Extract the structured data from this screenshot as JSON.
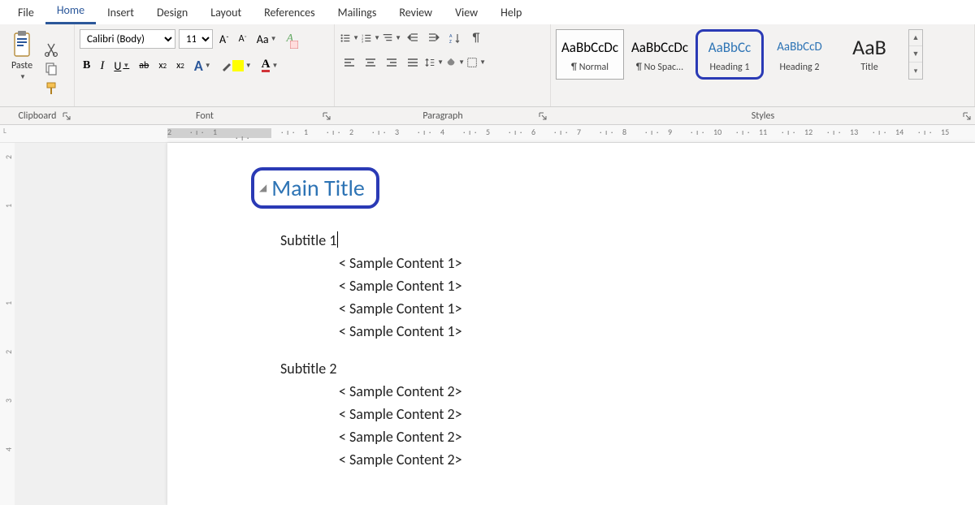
{
  "tabs": {
    "items": [
      "File",
      "Home",
      "Insert",
      "Design",
      "Layout",
      "References",
      "Mailings",
      "Review",
      "View",
      "Help"
    ],
    "active": "Home"
  },
  "ribbon": {
    "clipboard": {
      "label": "Clipboard",
      "paste": "Paste"
    },
    "font": {
      "label": "Font",
      "family": "Calibri (Body)",
      "size": "11",
      "bold": "B",
      "italic": "I",
      "underline": "U",
      "strike": "ab",
      "sub": "x",
      "sup": "x",
      "effects": "A",
      "fontcolor": "A",
      "incA": "A",
      "decA": "A",
      "aa": "Aa",
      "clearGlyph": "A"
    },
    "paragraph": {
      "label": "Paragraph",
      "pilcrow": "¶",
      "sort": "A↓Z"
    },
    "styles": {
      "label": "Styles",
      "items": [
        {
          "preview": "AaBbCcDc",
          "name": "¶ Normal",
          "cls": "",
          "sel": true
        },
        {
          "preview": "AaBbCcDc",
          "name": "¶ No Spac...",
          "cls": ""
        },
        {
          "preview": "AaBbCc",
          "name": "Heading 1",
          "cls": "h1",
          "hl": true
        },
        {
          "preview": "AaBbCcD",
          "name": "Heading 2",
          "cls": "h2"
        },
        {
          "preview": "AaB",
          "name": "Title",
          "cls": "title"
        }
      ]
    }
  },
  "ruler": {
    "marks": [
      "2",
      "1",
      "",
      "1",
      "2",
      "3",
      "4",
      "5",
      "6",
      "7",
      "8",
      "9",
      "10",
      "11",
      "12",
      "13",
      "14",
      "15"
    ],
    "vmarks": [
      "2",
      "1",
      "",
      "1",
      "2",
      "3",
      "4"
    ]
  },
  "document": {
    "main_title": "Main Title",
    "subtitle1": "Subtitle 1",
    "content1": [
      "< Sample Content 1>",
      "< Sample Content 1>",
      "< Sample Content 1>",
      "< Sample Content 1>"
    ],
    "subtitle2": "Subtitle 2",
    "content2": [
      "< Sample Content 2>",
      "< Sample Content 2>",
      "< Sample Content 2>",
      "< Sample Content 2>"
    ]
  }
}
